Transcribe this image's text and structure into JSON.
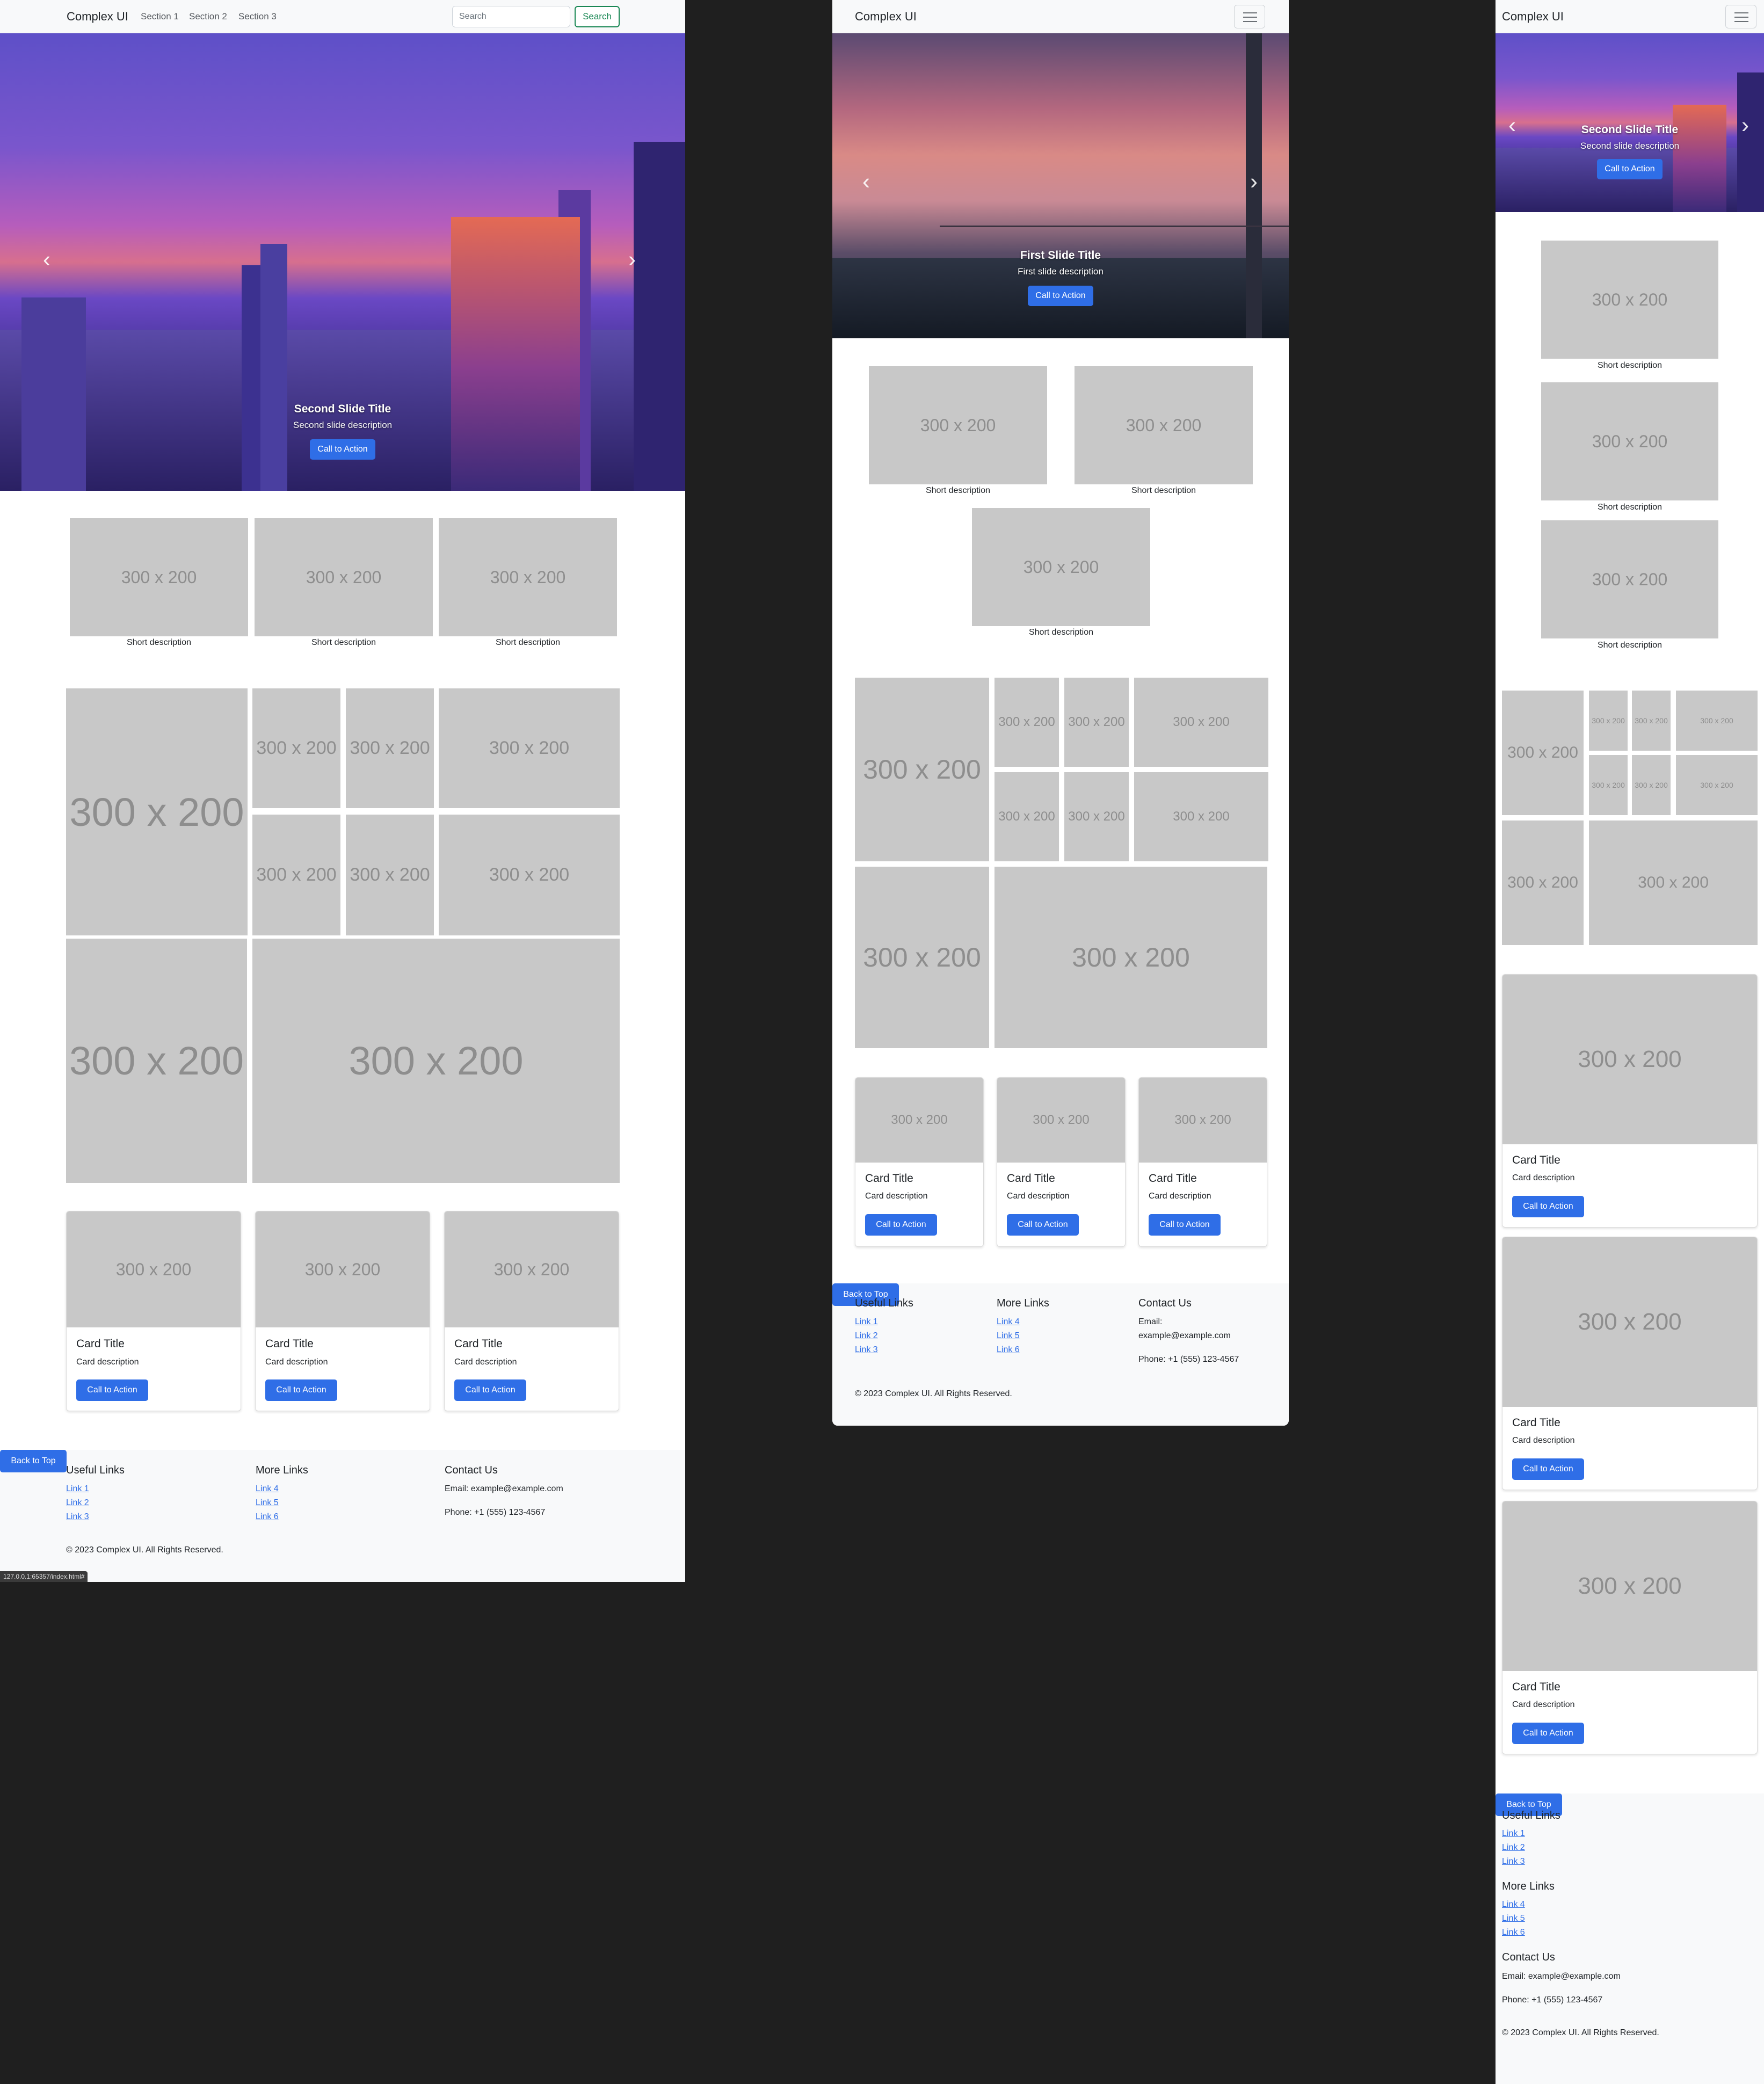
{
  "app": {
    "brand": "Complex UI",
    "nav_links": [
      "Section 1",
      "Section 2",
      "Section 3"
    ],
    "search_placeholder": "Search",
    "search_button": "Search"
  },
  "hero": {
    "slide1": {
      "title": "First Slide Title",
      "description": "First slide description",
      "cta": "Call to Action"
    },
    "slide2": {
      "title": "Second Slide Title",
      "description": "Second slide description",
      "cta": "Call to Action"
    }
  },
  "placeholder_text": "300 x 200",
  "featured": {
    "description": "Short description"
  },
  "cards": {
    "title": "Card Title",
    "description": "Card description",
    "cta": "Call to Action"
  },
  "footer": {
    "useful_links": {
      "heading": "Useful Links",
      "links": [
        "Link 1",
        "Link 2",
        "Link 3"
      ]
    },
    "more_links": {
      "heading": "More Links",
      "links": [
        "Link 4",
        "Link 5",
        "Link 6"
      ]
    },
    "contact": {
      "heading": "Contact Us",
      "email_label": "Email:",
      "email": "example@example.com",
      "email_full": "Email: example@example.com",
      "phone": "Phone: +1 (555) 123-4567"
    },
    "copyright": "© 2023 Complex UI. All Rights Reserved.",
    "back_to_top": "Back to Top"
  },
  "status_url": "127.0.0.1:65357/index.html#",
  "colors": {
    "primary": "#2f6ee7",
    "success": "#198754",
    "placeholder": "#c8c8c8",
    "navbar": "#f8f9fa",
    "backdrop": "#1f1f1f"
  }
}
